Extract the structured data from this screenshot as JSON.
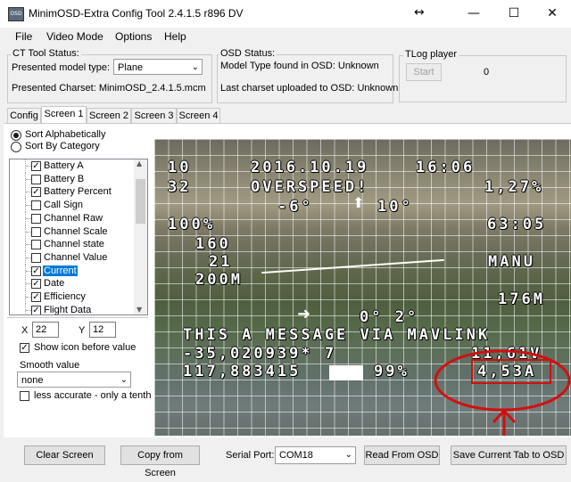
{
  "window": {
    "title": "MinimOSD-Extra Config Tool 2.4.1.5 r896 DV",
    "app_icon_text": "OSD",
    "resize_glyph": "↔",
    "minimize": "—",
    "maximize": "☐",
    "close": "✕"
  },
  "menu": [
    "File",
    "Video Mode",
    "Options",
    "Help"
  ],
  "ct_status": {
    "title": "CT Tool Status:",
    "model_label": "Presented model type:",
    "model_value": "Plane",
    "charset": "Presented Charset: MinimOSD_2.4.1.5.mcm"
  },
  "osd_status": {
    "title": "OSD Status:",
    "model_found": "Model Type found in OSD: Unknown",
    "charset_uploaded": "Last charset uploaded to OSD: Unknown"
  },
  "tlog": {
    "title": "TLog player",
    "start_label": "Start",
    "counter": "0"
  },
  "tabs": [
    "Config",
    "Screen 1",
    "Screen 2",
    "Screen 3",
    "Screen 4"
  ],
  "active_tab": "Screen 1",
  "sort": {
    "alphabetical": "Sort Alphabetically",
    "by_category": "Sort By Category"
  },
  "items": [
    {
      "label": "Battery A",
      "checked": true
    },
    {
      "label": "Battery B",
      "checked": false
    },
    {
      "label": "Battery Percent",
      "checked": true
    },
    {
      "label": "Call Sign",
      "checked": false
    },
    {
      "label": "Channel Raw",
      "checked": false
    },
    {
      "label": "Channel Scale",
      "checked": false
    },
    {
      "label": "Channel state",
      "checked": false
    },
    {
      "label": "Channel Value",
      "checked": false
    },
    {
      "label": "Current",
      "checked": true
    },
    {
      "label": "Date",
      "checked": true
    },
    {
      "label": "Efficiency",
      "checked": true
    },
    {
      "label": "Flight Data",
      "checked": true
    }
  ],
  "selected_item": "Current",
  "position": {
    "x_label": "X",
    "x_value": "22",
    "y_label": "Y",
    "y_value": "12"
  },
  "show_icon_label": "Show icon before value",
  "show_icon_checked": true,
  "smooth": {
    "label": "Smooth value",
    "value": "none"
  },
  "less_accurate_label": "less accurate - only a tenth",
  "osd": {
    "date": "2016.10.19",
    "time": "16:06",
    "alt_prefix": "10",
    "speed_prefix": "32",
    "overspeed": "OVERSPEED!",
    "batt_percent": "1,27%",
    "heading": "-6°",
    "pitch": "10°",
    "throttle": "100%",
    "flight_time": "63:05",
    "home_dist": "160",
    "climb": "21",
    "mode": "MANU",
    "wp_dist": "200M",
    "home_dir": "176M",
    "roll": "0°  2°",
    "message": "THIS A MESSAGE VIA MAVLINK",
    "lat": "-35,020939* 7",
    "voltage": "11,61V",
    "lon": "117,883415",
    "rssi": "99%",
    "current": "4,53A"
  },
  "buttons": {
    "clear": "Clear Screen",
    "copy": "Copy from Screen",
    "serial_label": "Serial Port:",
    "serial_value": "COM18",
    "read": "Read From OSD",
    "save": "Save Current Tab to OSD"
  },
  "colors": {
    "accent": "#0078d7",
    "annotation": "#d01010"
  }
}
